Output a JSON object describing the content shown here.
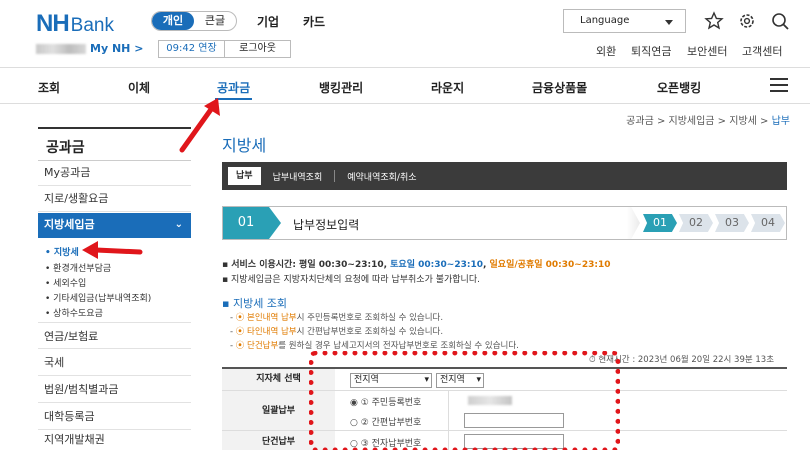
{
  "header": {
    "logo_nh": "NH",
    "logo_bank": "Bank",
    "segment": [
      "개인",
      "큰글"
    ],
    "top_tabs": [
      "기업",
      "카드"
    ],
    "language": "Language",
    "user_label": "My NH >",
    "session_time": "09:42 연장",
    "logout": "로그아웃",
    "util_links": [
      "외환",
      "퇴직연금",
      "보안센터",
      "고객센터"
    ]
  },
  "gnb": [
    "조회",
    "이체",
    "공과금",
    "뱅킹관리",
    "라운지",
    "금융상품몰",
    "오픈뱅킹"
  ],
  "breadcrumb": {
    "path": "공과금 > 지방세입금 > 지방세 > ",
    "current": "납부"
  },
  "sidebar": {
    "title": "공과금",
    "items": [
      "My공과금",
      "지로/생활요금",
      "지방세입금",
      "연금/보험료",
      "국세",
      "법원/범칙별과금",
      "대학등록금",
      "지역개발채권"
    ],
    "sub_items": [
      "• 지방세",
      "• 환경개선부담금",
      "• 세외수입",
      "• 기타세입금(납부내역조회)",
      "• 상하수도요금"
    ],
    "selected_chevron": "⌄"
  },
  "main": {
    "title": "지방세",
    "tabs": [
      "납부",
      "납부내역조회",
      "예약내역조회/취소"
    ],
    "step_num": "01",
    "step_label": "납부정보입력",
    "steps": [
      "01",
      "02",
      "03",
      "04"
    ],
    "service_prefix": "서비스 이용시간: 평일 00:30~23:10, ",
    "service_sat": "토요일 00:30~23:10",
    "service_sep": ", ",
    "service_sun": "일요일/공휴일 00:30~23:10",
    "note2": "지방세입금은 지방자치단체의 요청에 따라 납부취소가 불가합니다.",
    "section_title": "지방세 조회",
    "guide": [
      {
        "prefix": "- ",
        "circle": "⦿",
        "highlight": "본인내역 납부",
        "rest": "시 주민등록번호로 조회하실 수 있습니다."
      },
      {
        "prefix": "- ",
        "circle": "⦿",
        "highlight": "타인내역 납부",
        "rest": "시 간편납부번호로 조회하실 수 있습니다."
      },
      {
        "prefix": "- ",
        "circle": "⦿",
        "highlight": "단건납부",
        "rest": "를 원하실 경우 납세고지서의 전자납부번호로 조회하실 수 있습니다."
      }
    ],
    "timestamp": "⏱ 현재시간 : 2023년 06월 20일 22시 39분 13초",
    "form": {
      "region_label": "지자체 선택",
      "region_select1": "전지역",
      "region_select2": "전지역",
      "general_label": "일괄납부",
      "radio1": "◉ ① 주민등록번호",
      "radio2": "○ ② 간편납부번호",
      "single_label": "단건납부",
      "radio3": "○ ③ 전자납부번호"
    }
  }
}
